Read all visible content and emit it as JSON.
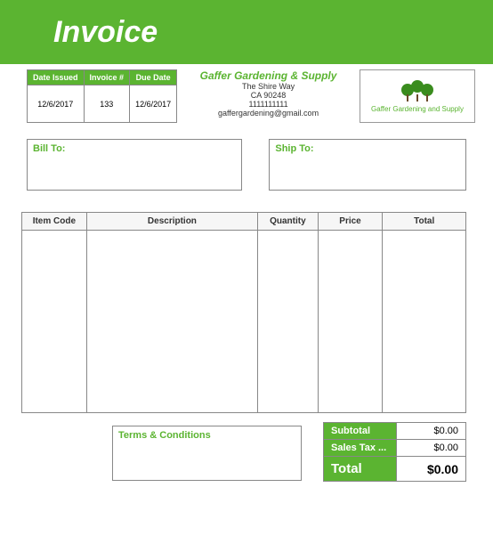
{
  "title": "Invoice",
  "meta": {
    "headers": {
      "date_issued": "Date Issued",
      "invoice_no": "Invoice #",
      "due_date": "Due Date"
    },
    "values": {
      "date_issued": "12/6/2017",
      "invoice_no": "133",
      "due_date": "12/6/2017"
    }
  },
  "company": {
    "name": "Gaffer Gardening & Supply",
    "addr1": "The Shire Way",
    "addr2": "CA 90248",
    "phone": "1111111111",
    "email": "gaffergardening@gmail.com",
    "logo_caption": "Gaffer Gardening and Supply"
  },
  "bill_to": {
    "label": "Bill To:"
  },
  "ship_to": {
    "label": "Ship To:"
  },
  "items": {
    "headers": {
      "code": "Item Code",
      "desc": "Description",
      "qty": "Quantity",
      "price": "Price",
      "total": "Total"
    }
  },
  "terms": {
    "label": "Terms & Conditions"
  },
  "totals": {
    "subtotal_label": "Subtotal",
    "subtotal_value": "$0.00",
    "tax_label": "Sales Tax ...",
    "tax_value": "$0.00",
    "total_label": "Total",
    "total_value": "$0.00"
  }
}
